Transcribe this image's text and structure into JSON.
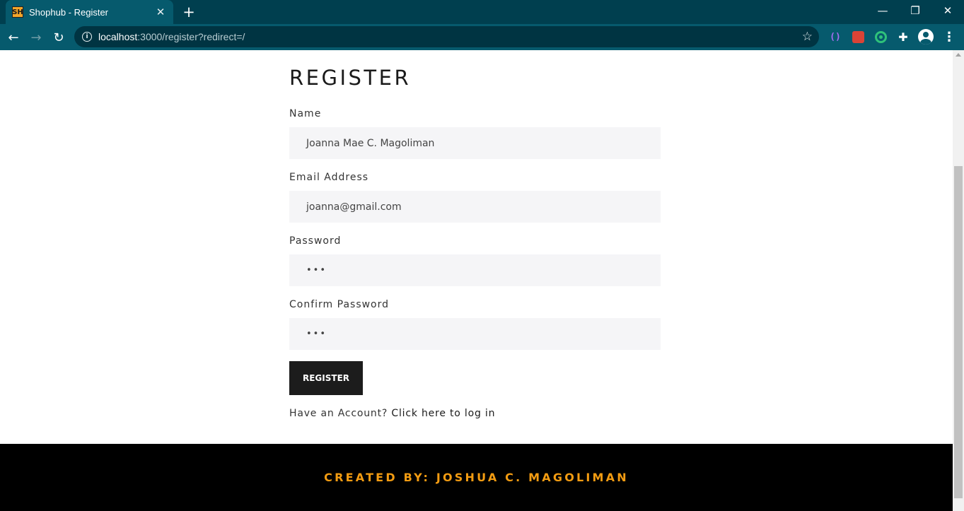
{
  "browser": {
    "tab_title": "Shophub - Register",
    "favicon_text": "SH",
    "url_host": "localhost",
    "url_path": ":3000/register?redirect=/"
  },
  "page": {
    "heading": "REGISTER",
    "fields": {
      "name_label": "Name",
      "name_value": "Joanna Mae C. Magoliman",
      "email_label": "Email Address",
      "email_value": "joanna@gmail.com",
      "password_label": "Password",
      "password_value": "•••",
      "confirm_label": "Confirm Password",
      "confirm_value": "•••"
    },
    "submit_label": "REGISTER",
    "login_prompt": "Have an Account? ",
    "login_link": "Click here to log in"
  },
  "footer": {
    "credit": "CREATED BY: JOSHUA C. MAGOLIMAN"
  },
  "colors": {
    "chrome_bg": "#003f4f",
    "chrome_active": "#065a6d",
    "footer_accent": "#f39c12",
    "button_bg": "#1c1c1c"
  }
}
